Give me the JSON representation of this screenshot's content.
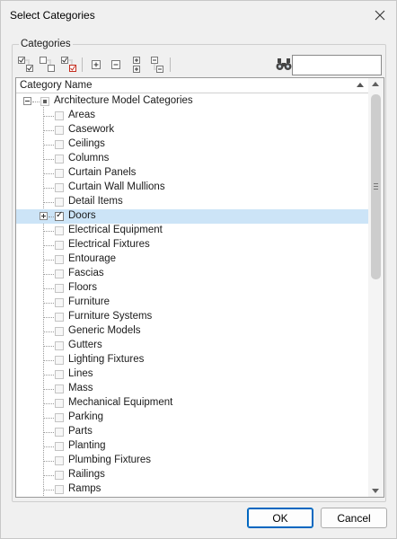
{
  "window": {
    "title": "Select Categories"
  },
  "group": {
    "label": "Categories"
  },
  "toolbar": {
    "buttons": [
      "check-all-icon",
      "uncheck-all-icon",
      "invert-check-icon",
      "expand-icon",
      "collapse-icon",
      "expand-all-icon",
      "collapse-all-icon"
    ],
    "search_value": ""
  },
  "tree": {
    "header": "Category Name",
    "root": {
      "label": "Architecture Model Categories",
      "state": "partial",
      "expanded": true
    },
    "items": [
      {
        "label": "Areas",
        "checked": false
      },
      {
        "label": "Casework",
        "checked": false
      },
      {
        "label": "Ceilings",
        "checked": false
      },
      {
        "label": "Columns",
        "checked": false
      },
      {
        "label": "Curtain Panels",
        "checked": false
      },
      {
        "label": "Curtain Wall Mullions",
        "checked": false
      },
      {
        "label": "Detail Items",
        "checked": false
      },
      {
        "label": "Doors",
        "checked": true,
        "selected": true,
        "has_children": true
      },
      {
        "label": "Electrical Equipment",
        "checked": false
      },
      {
        "label": "Electrical Fixtures",
        "checked": false
      },
      {
        "label": "Entourage",
        "checked": false
      },
      {
        "label": "Fascias",
        "checked": false
      },
      {
        "label": "Floors",
        "checked": false
      },
      {
        "label": "Furniture",
        "checked": false
      },
      {
        "label": "Furniture Systems",
        "checked": false
      },
      {
        "label": "Generic Models",
        "checked": false
      },
      {
        "label": "Gutters",
        "checked": false
      },
      {
        "label": "Lighting Fixtures",
        "checked": false
      },
      {
        "label": "Lines",
        "checked": false
      },
      {
        "label": "Mass",
        "checked": false
      },
      {
        "label": "Mechanical Equipment",
        "checked": false
      },
      {
        "label": "Parking",
        "checked": false
      },
      {
        "label": "Parts",
        "checked": false
      },
      {
        "label": "Planting",
        "checked": false
      },
      {
        "label": "Plumbing Fixtures",
        "checked": false
      },
      {
        "label": "Railings",
        "checked": false
      },
      {
        "label": "Ramps",
        "checked": false
      }
    ]
  },
  "buttons": {
    "ok": "OK",
    "cancel": "Cancel"
  },
  "colors": {
    "selection": "#cce4f7",
    "accent": "#0067c0",
    "check_red": "#c42b1c"
  }
}
